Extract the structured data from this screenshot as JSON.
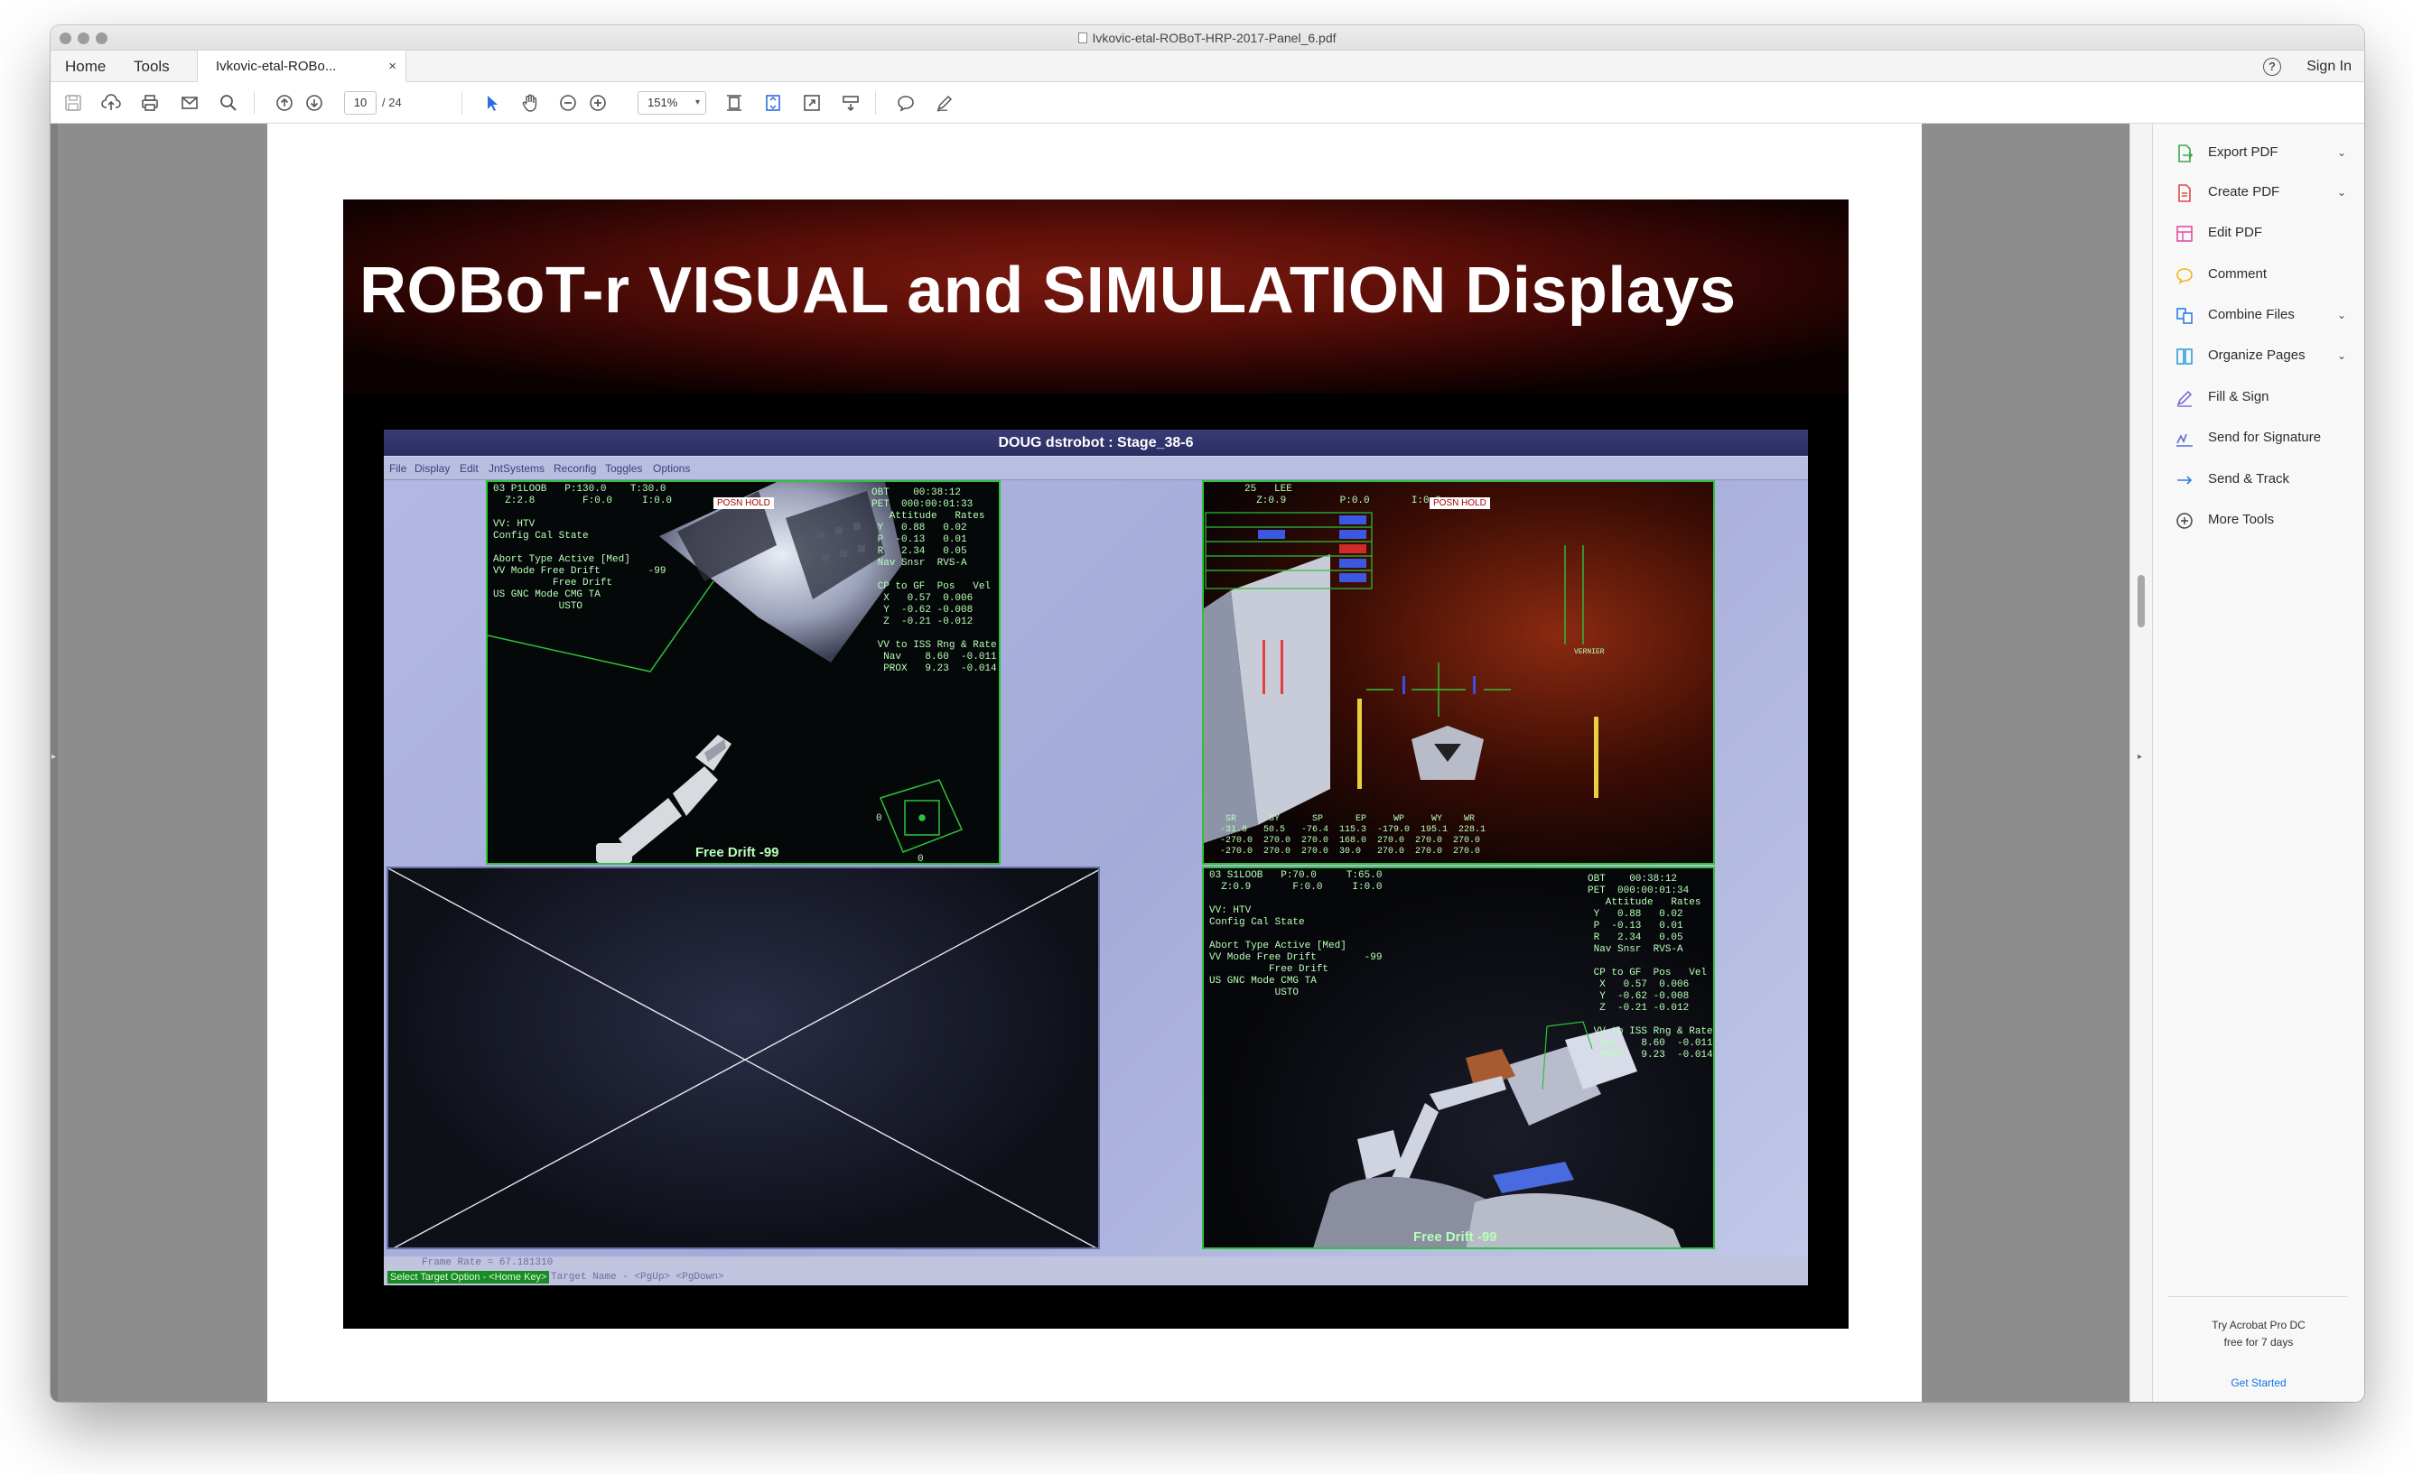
{
  "window": {
    "title": "Ivkovic-etal-ROBoT-HRP-2017-Panel_6.pdf"
  },
  "tabs": {
    "home": "Home",
    "tools": "Tools",
    "document": "Ivkovic-etal-ROBo...",
    "close": "×"
  },
  "header": {
    "sign_in": "Sign In",
    "help": "?"
  },
  "toolbar": {
    "page_current": "10",
    "page_total": "/ 24",
    "zoom": "151%",
    "icons": [
      "save-icon",
      "upload-icon",
      "print-icon",
      "email-icon",
      "search-icon",
      "prev-page-icon",
      "next-page-icon",
      "select-cursor-icon",
      "hand-icon",
      "zoom-out-icon",
      "zoom-in-icon",
      "fit-page-icon",
      "scroll-mode-icon",
      "full-screen-icon",
      "read-mode-icon",
      "comment-icon",
      "sign-icon"
    ]
  },
  "slide": {
    "title": "ROBoT-r VISUAL and SIMULATION Displays",
    "sim": {
      "titlebar": "DOUG   dstrobot : Stage_38-6",
      "menu": [
        "File",
        "Display",
        "Edit",
        "JntSystems",
        "Reconfig",
        "Toggles",
        "Options"
      ],
      "top_left_hud": "03 P1LOOB   P:130.0    T:30.0\n  Z:2.8        F:0.0     I:0.0\n\nVV: HTV\nConfig Cal State\n\nAbort Type Active [Med]\nVV Mode Free Drift        -99\n          Free Drift\nUS GNC Mode CMG TA\n           USTO",
      "top_left_right_hud": "OBT    00:38:12\nPET  000:00:01:33\n   Attitude   Rates\n Y   0.88   0.02\n P  -0.13   0.01\n R   2.34   0.05\n Nav Snsr  RVS-A\n\n CP to GF  Pos   Vel\n  X   0.57  0.006\n  Y  -0.62 -0.008\n  Z  -0.21 -0.012\n\n VV to ISS Rng & Rate\n  Nav    8.60  -0.011\n  PROX   9.23  -0.014",
      "top_left_badge": "POSN HOLD",
      "top_left_freedrift": "Free Drift  -99",
      "top_right_hud": "25   LEE\n  Z:0.9         P:0.0       I:0.0",
      "top_right_badge": "POSN HOLD",
      "top_right_bottom_hud": "   SR      SY      SP      EP     WP     WY    WR\n  -31.8   50.5   -76.4  115.3  -179.0  195.1  228.1\n  -270.0  270.0  270.0  168.0  270.0  270.0  270.0\n  -270.0  270.0  270.0  30.0   270.0  270.0  270.0",
      "bottom_right_hud": "03 S1LOOB   P:70.0     T:65.0\n  Z:0.9       F:0.0     I:0.0\n\nVV: HTV\nConfig Cal State\n\nAbort Type Active [Med]\nVV Mode Free Drift        -99\n          Free Drift\nUS GNC Mode CMG TA\n           USTO",
      "bottom_right_right_hud": "OBT    00:38:12\nPET  000:00:01:34\n   Attitude   Rates\n Y   0.88   0.02\n P  -0.13   0.01\n R   2.34   0.05\n Nav Snsr  RVS-A\n\n CP to GF  Pos   Vel\n  X   0.57  0.006\n  Y  -0.62 -0.008\n  Z  -0.21 -0.012\n\n VV to ISS Rng & Rate\n  Nav    8.60  -0.011\n  PROX   9.23  -0.014",
      "bottom_right_freedrift": "Free Drift  -99",
      "status_frame": "Frame Rate = 67.181310",
      "status_target_option": "Select Target Option - <Home Key>",
      "status_target_name": "Target Name - <PgUp> <PgDown>"
    }
  },
  "tools_pane": {
    "items": [
      {
        "label": "Export PDF",
        "icon": "export-pdf-icon",
        "color": "#3da74e",
        "chevron": "⌄"
      },
      {
        "label": "Create PDF",
        "icon": "create-pdf-icon",
        "color": "#e34850",
        "chevron": "⌄"
      },
      {
        "label": "Edit PDF",
        "icon": "edit-pdf-icon",
        "color": "#e34ea0",
        "chevron": ""
      },
      {
        "label": "Comment",
        "icon": "comment-icon",
        "color": "#f0b51c",
        "chevron": ""
      },
      {
        "label": "Combine Files",
        "icon": "combine-files-icon",
        "color": "#2d7fe0",
        "chevron": "⌄"
      },
      {
        "label": "Organize Pages",
        "icon": "organize-pages-icon",
        "color": "#2d9fe0",
        "chevron": "⌄"
      },
      {
        "label": "Fill & Sign",
        "icon": "fill-sign-icon",
        "color": "#7a5bd6",
        "chevron": ""
      },
      {
        "label": "Send for Signature",
        "icon": "send-signature-icon",
        "color": "#5b6bd6",
        "chevron": ""
      },
      {
        "label": "Send & Track",
        "icon": "send-track-icon",
        "color": "#2d7fe0",
        "chevron": ""
      },
      {
        "label": "More Tools",
        "icon": "more-tools-icon",
        "color": "#444444",
        "chevron": ""
      }
    ],
    "promo_line1": "Try Acrobat Pro DC",
    "promo_line2": "free for 7 days",
    "get_started": "Get Started"
  }
}
